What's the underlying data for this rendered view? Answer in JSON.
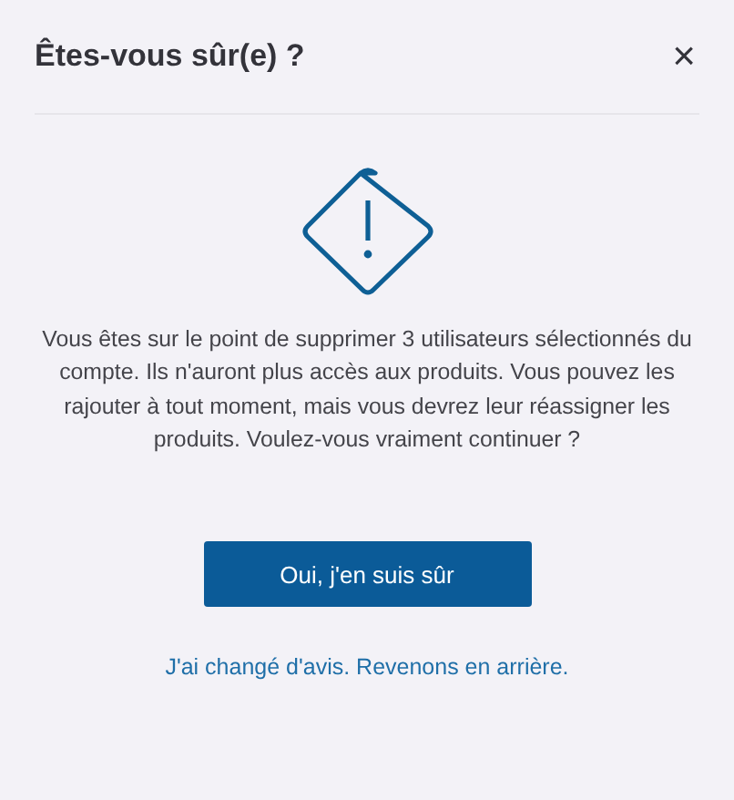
{
  "dialog": {
    "title": "Êtes-vous sûr(e) ?",
    "close": "×",
    "message": "Vous êtes sur le point de supprimer 3 utilisateurs sélectionnés du compte. Ils n'auront plus accès aux produits. Vous pouvez les rajouter à tout moment, mais vous devrez leur réassigner les produits. Voulez-vous vraiment continuer ?",
    "confirm_button": "Oui, j'en suis sûr",
    "cancel_link": "J'ai changé d'avis. Revenons en arrière."
  }
}
